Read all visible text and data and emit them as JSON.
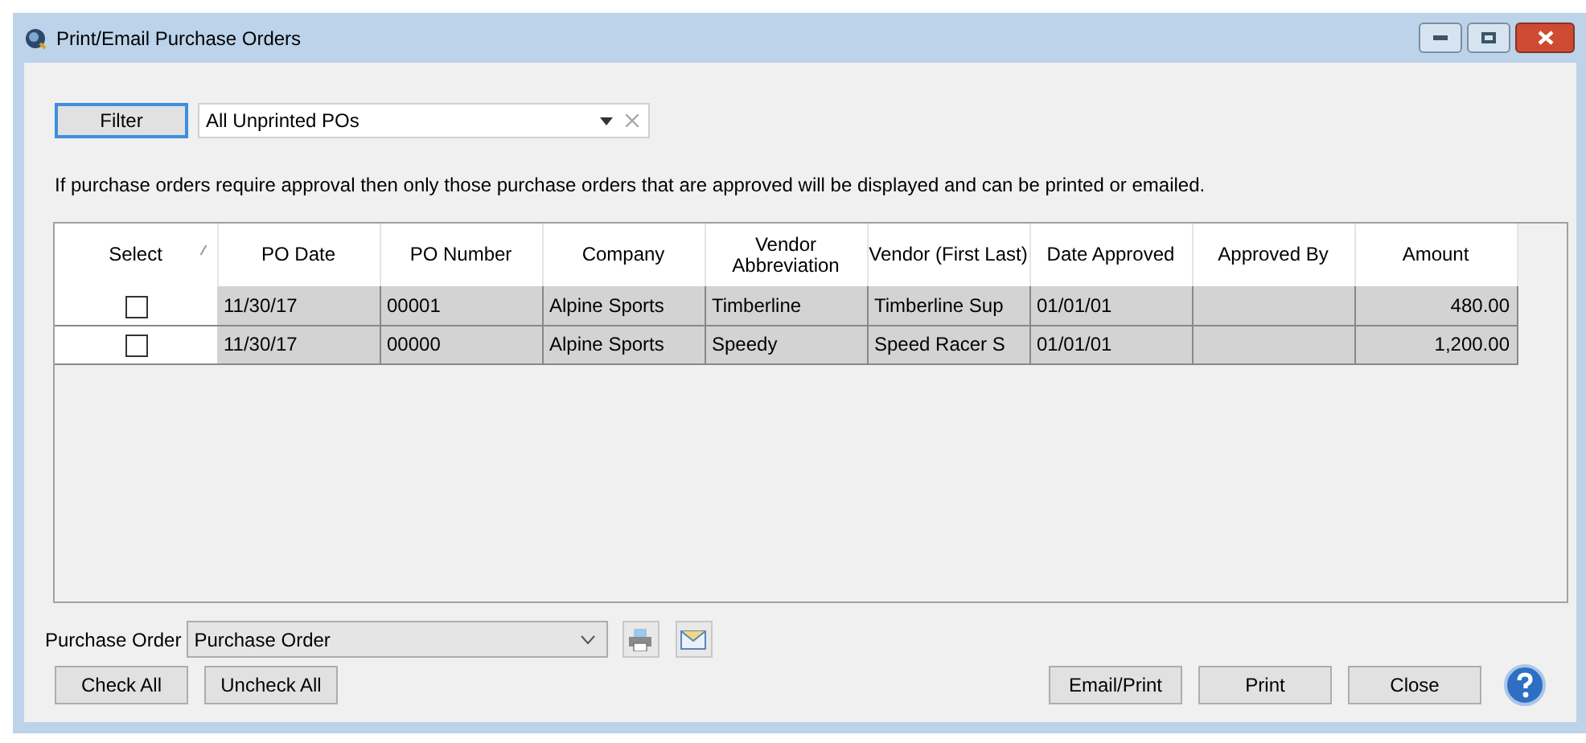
{
  "window": {
    "title": "Print/Email Purchase Orders"
  },
  "filter": {
    "button": "Filter",
    "value": "All Unprinted POs"
  },
  "notice": "If purchase orders require approval then only those purchase orders that are approved will be displayed and can be printed or emailed.",
  "table": {
    "columns": [
      {
        "label": "Select",
        "sorted": true
      },
      {
        "label": "PO Date",
        "sorted": false
      },
      {
        "label": "PO Number",
        "sorted": false
      },
      {
        "label": "Company",
        "sorted": false
      },
      {
        "label": "Vendor Abbreviation",
        "sorted": false
      },
      {
        "label": "Vendor (First Last)",
        "sorted": false
      },
      {
        "label": "Date Approved",
        "sorted": false
      },
      {
        "label": "Approved By",
        "sorted": false
      },
      {
        "label": "Amount",
        "sorted": false
      }
    ],
    "rows": [
      {
        "checked": false,
        "cells": [
          "",
          "11/30/17",
          "00001",
          "Alpine Sports",
          "Timberline",
          "Timberline Sup",
          "01/01/01",
          "",
          "480.00"
        ]
      },
      {
        "checked": false,
        "cells": [
          "",
          "11/30/17",
          "00000",
          "Alpine Sports",
          "Speedy",
          "Speed Racer S",
          "01/01/01",
          "",
          "1,200.00"
        ]
      }
    ]
  },
  "form": {
    "label": "Purchase Order",
    "value": "Purchase Order"
  },
  "left_buttons": [
    "Check All",
    "Uncheck All"
  ],
  "right_buttons": [
    "Email/Print",
    "Print",
    "Close"
  ]
}
